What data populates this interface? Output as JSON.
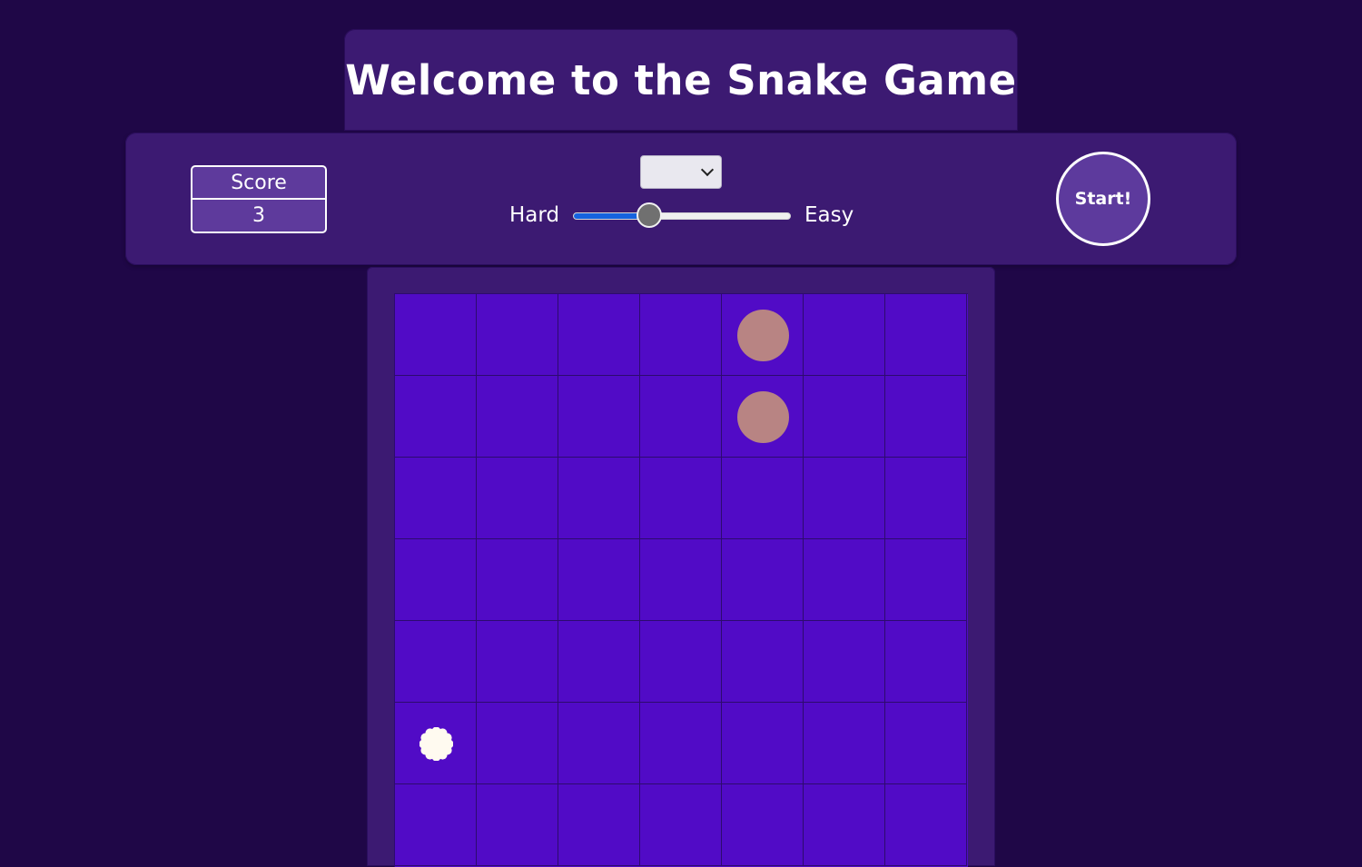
{
  "header": {
    "title": "Welcome to the Snake Game"
  },
  "score": {
    "label": "Score",
    "value": "3"
  },
  "difficulty": {
    "select_value": "",
    "hard_label": "Hard",
    "easy_label": "Easy",
    "slider_level": 0.35,
    "slider_fill_color": "#1563e0"
  },
  "start_button": {
    "label": "Start!"
  },
  "board": {
    "columns": 7,
    "rows": 7,
    "snake_cells": [
      {
        "row": 0,
        "col": 4
      },
      {
        "row": 1,
        "col": 4
      }
    ],
    "food_cell": {
      "row": 5,
      "col": 0
    },
    "cell_color": "#510bc6",
    "snake_color": "#b88483",
    "food_color": "#fffaf0"
  }
}
